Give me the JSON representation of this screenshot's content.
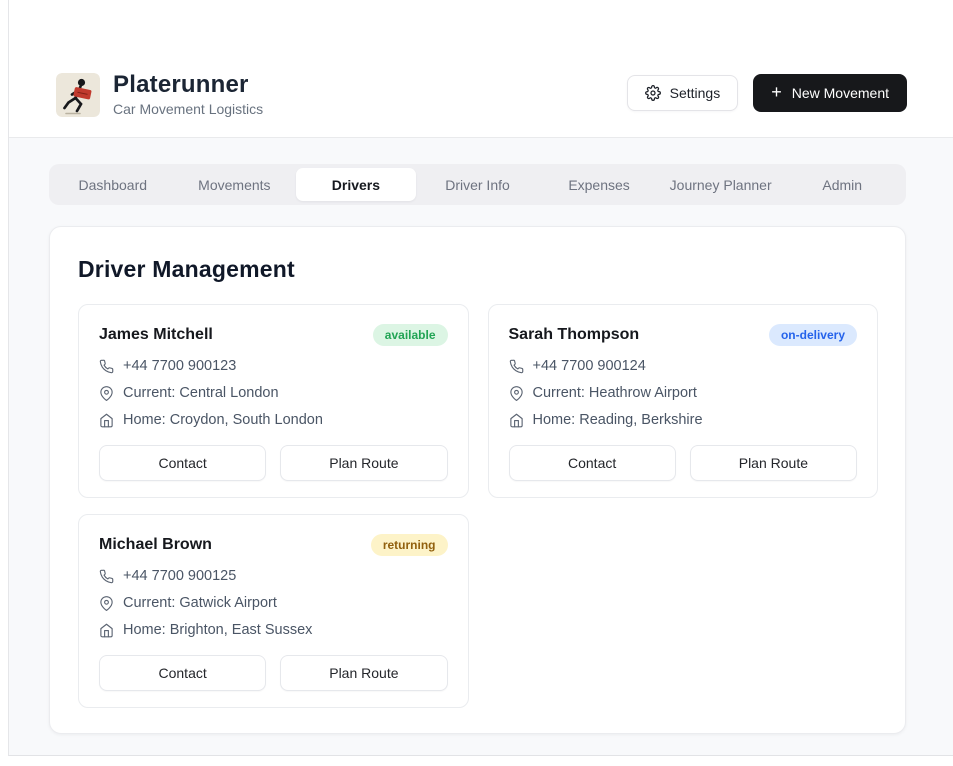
{
  "app": {
    "title": "Platerunner",
    "subtitle": "Car Movement Logistics",
    "logo_icon": "running-courier-with-plate-icon",
    "accent_dark": "#17181b",
    "body_bg": "#f8f9fb"
  },
  "header": {
    "settings_label": "Settings",
    "settings_icon": "gear-icon",
    "new_movement_label": "New Movement",
    "new_movement_icon": "plus-icon",
    "plus_glyph": "+"
  },
  "tabs": [
    {
      "label": "Dashboard",
      "active": false
    },
    {
      "label": "Movements",
      "active": false
    },
    {
      "label": "Drivers",
      "active": true
    },
    {
      "label": "Driver Info",
      "active": false
    },
    {
      "label": "Expenses",
      "active": false
    },
    {
      "label": "Journey Planner",
      "active": false
    },
    {
      "label": "Admin",
      "active": false
    }
  ],
  "main": {
    "heading": "Driver Management",
    "card_actions": {
      "contact": "Contact",
      "plan_route": "Plan Route"
    },
    "info_icons": {
      "phone": "phone-icon",
      "current": "map-pin-icon",
      "home": "home-icon"
    },
    "drivers": [
      {
        "name": "James Mitchell",
        "status": "available",
        "status_bg": "#dcf5e4",
        "status_text": "#21a454",
        "phone": "+44 7700 900123",
        "current": "Current: Central London",
        "home": "Home: Croydon, South London"
      },
      {
        "name": "Sarah Thompson",
        "status": "on-delivery",
        "status_bg": "#dbe9fe",
        "status_text": "#2563eb",
        "phone": "+44 7700 900124",
        "current": "Current: Heathrow Airport",
        "home": "Home: Reading, Berkshire"
      },
      {
        "name": "Michael Brown",
        "status": "returning",
        "status_bg": "#fdf3c8",
        "status_text": "#92610e",
        "phone": "+44 7700 900125",
        "current": "Current: Gatwick Airport",
        "home": "Home: Brighton, East Sussex"
      }
    ]
  }
}
